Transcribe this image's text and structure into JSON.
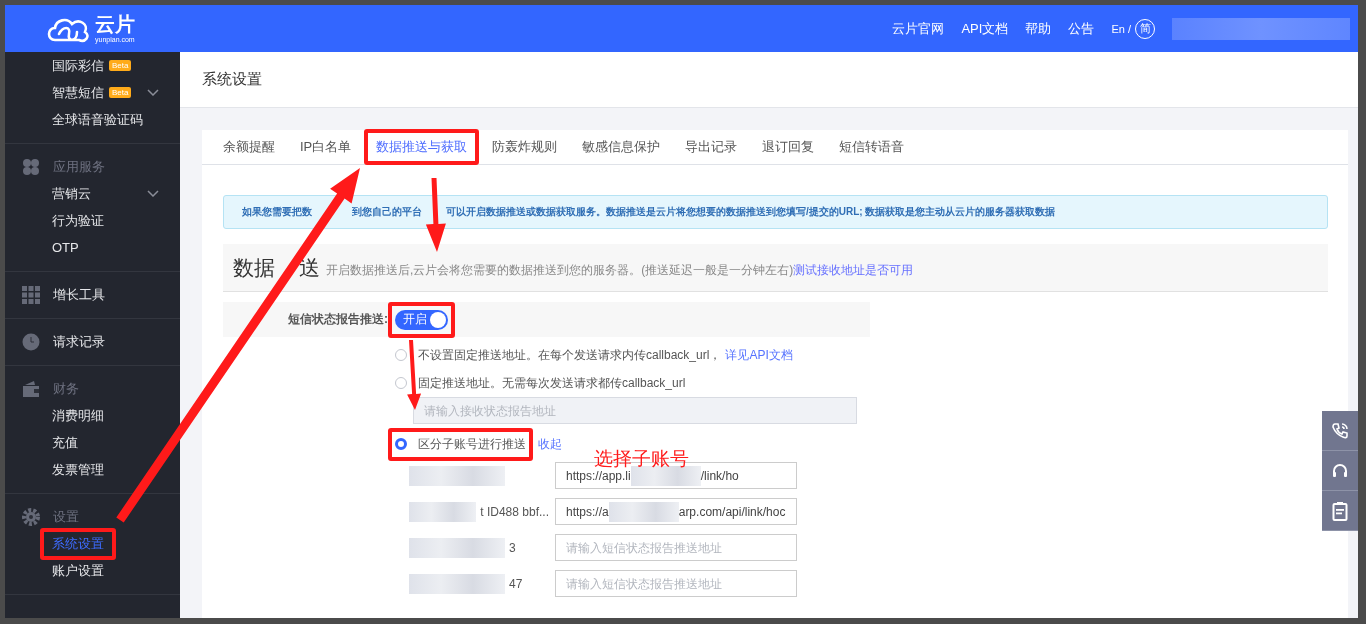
{
  "header": {
    "logo_text": "云片",
    "logo_sub": "yunpian.com",
    "nav": [
      {
        "label": "云片官网"
      },
      {
        "label": "API文档"
      },
      {
        "label": "帮助"
      },
      {
        "label": "公告"
      }
    ],
    "lang": {
      "en": "En /",
      "zh": "简"
    }
  },
  "sidebar": {
    "groups": [
      {
        "kind": "none",
        "items": [
          {
            "label": "国际彩信",
            "badge": "Beta",
            "expandable": false,
            "selected": false
          },
          {
            "label": "智慧短信",
            "badge": "Beta",
            "expandable": true,
            "selected": false
          },
          {
            "label": "全球语音验证码",
            "expandable": false,
            "selected": false
          }
        ]
      },
      {
        "label": "应用服务",
        "kind": "section",
        "items": [
          {
            "label": "营销云",
            "expandable": true,
            "selected": false
          },
          {
            "label": "行为验证",
            "expandable": false,
            "selected": false
          },
          {
            "label": "OTP",
            "expandable": false,
            "selected": false
          }
        ]
      },
      {
        "label": "增长工具",
        "kind": "link"
      },
      {
        "label": "请求记录",
        "kind": "link"
      },
      {
        "label": "财务",
        "kind": "section",
        "items": [
          {
            "label": "消费明细",
            "expandable": false,
            "selected": false
          },
          {
            "label": "充值",
            "expandable": false,
            "selected": false
          },
          {
            "label": "发票管理",
            "expandable": false,
            "selected": false
          }
        ]
      },
      {
        "label": "设置",
        "kind": "section",
        "items": [
          {
            "label": "系统设置",
            "expandable": false,
            "selected": true
          },
          {
            "label": "账户设置",
            "expandable": false,
            "selected": false
          }
        ]
      }
    ]
  },
  "page_title": "系统设置",
  "tabs": [
    {
      "label": "余额提醒",
      "selected": false
    },
    {
      "label": "IP白名单",
      "selected": false
    },
    {
      "label": "数据推送与获取",
      "selected": true
    },
    {
      "label": "防轰炸规则",
      "selected": false
    },
    {
      "label": "敏感信息保护",
      "selected": false
    },
    {
      "label": "导出记录",
      "selected": false
    },
    {
      "label": "退订回复",
      "selected": false
    },
    {
      "label": "短信转语音",
      "selected": false
    }
  ],
  "alert": [
    "如果您需要把数",
    "到您自己的平台",
    "可以开启数据推送或数据获取服务。数据推送是云片将您想要的数据推送到您填写/提交的URL; 数据获取是您主动从云片的服务器获取数据"
  ],
  "section": {
    "title_start": "数据",
    "title_end": "送",
    "description": "开启数据推送后,云片会将您需要的数据推送到您的服务器。(推送延迟一般是一分钟左右)",
    "link": "测试接收地址是否可用"
  },
  "report_push": {
    "label": "短信状态报告推送:",
    "on": true,
    "toggle_text": "开启"
  },
  "options": [
    {
      "kind": "link",
      "label": "不设置固定推送地址。在每个发送请求内传callback_url，",
      "link": "详见API文档",
      "selected": false
    },
    {
      "kind": "input",
      "label": "固定推送地址。无需每次发送请求都传callback_url",
      "placeholder": "请输入接收状态报告地址",
      "selected": false
    },
    {
      "kind": "link",
      "label": "区分子账号进行推送",
      "link": "收起",
      "selected": true
    }
  ],
  "sub_accounts": [
    {
      "url_start": "https://app.li",
      "url_end": "/link/ho"
    },
    {
      "name_tail": "t ID488 bbf...",
      "url_start": "https://a",
      "url_end": "arp.com/api/link/hoc"
    },
    {
      "name_tail": "3",
      "placeholder": "请输入短信状态报告推送地址"
    },
    {
      "name_tail": "47",
      "placeholder": "请输入短信状态报告推送地址"
    }
  ],
  "annotation_note": "选择子账号"
}
